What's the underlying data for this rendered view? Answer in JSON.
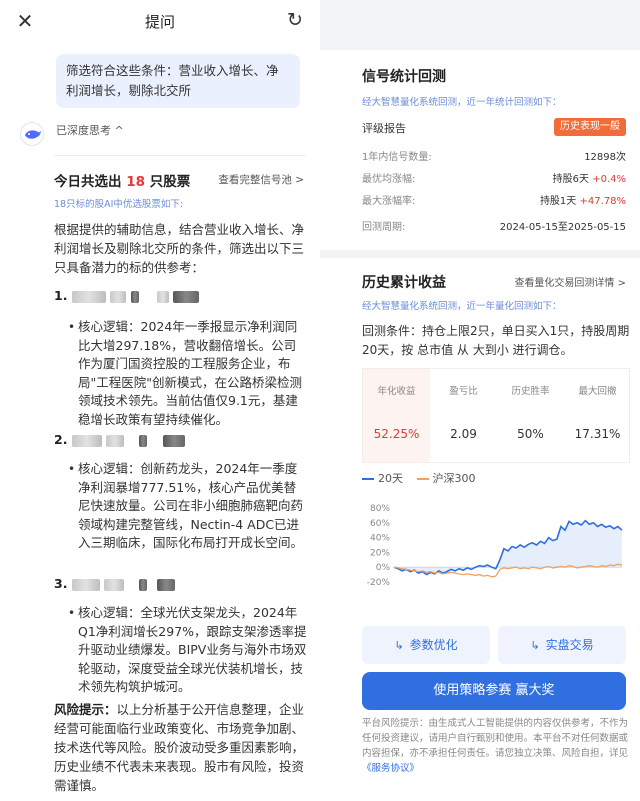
{
  "header": {
    "close_icon": "close-icon",
    "title": "提问",
    "refresh_icon": "refresh-icon"
  },
  "query": {
    "text": "筛选符合这些条件：营业收入增长、净利润增长，剔除北交所"
  },
  "thinking": {
    "label": "已深度思考 ^"
  },
  "result": {
    "head_prefix": "今日共选出",
    "count": "18",
    "head_suffix": "只股票",
    "link": "查看完整信号池 >",
    "sub": "18只标的股AI中优选股票如下:",
    "intro": "根据提供的辅助信息，结合营业收入增长、净利润增长及剔除北交所的条件，筛选出以下三只具备潜力的标的供参考：",
    "items": [
      {
        "index": "1.",
        "body": "核心逻辑：2024年一季报显示净利润同比大增297.18%，营收翻倍增长。公司作为厦门国资控股的工程服务企业，布局\"工程医院\"创新模式，在公路桥梁检测领域技术领先。当前估值仅9.1元，基建稳增长政策有望持续催化。"
      },
      {
        "index": "2.",
        "body": "核心逻辑：创新药龙头，2024年一季度净利润暴增777.51%，核心产品优美替尼快速放量。公司在非小细胞肺癌靶向药领域构建完整管线，Nectin-4 ADC已进入三期临床，国际化布局打开成长空间。"
      },
      {
        "index": "3.",
        "body": "核心逻辑：全球光伏支架龙头，2024年Q1净利润增长297%，跟踪支架渗透率提升驱动业绩爆发。BIPV业务与海外市场双轮驱动，深度受益全球光伏装机增长，技术领先构筑护城河。"
      }
    ],
    "risk_label": "风险提示：",
    "risk_text": "以上分析基于公开信息整理，企业经营可能面临行业政策变化、市场竞争加剧、技术迭代等风险。股价波动受多重因素影响，历史业绩不代表未来表现。股市有风险，投资需谨慎。"
  },
  "signal": {
    "title": "信号统计回测",
    "sub": "经大智慧量化系统回测，近一年统计回测如下：",
    "rating_label": "评级报告",
    "rating_badge": "历史表现一般",
    "rows": [
      {
        "k": "1年内信号数量:",
        "v": "12898次",
        "v_red": ""
      },
      {
        "k": "最优均涨幅:",
        "v": "持股6天 ",
        "v_red": "+0.4%"
      },
      {
        "k": "最大涨幅率:",
        "v": "持股1天 ",
        "v_red": "+47.78%"
      },
      {
        "k": "回测周期:",
        "v": "2024-05-15至2025-05-15",
        "v_red": ""
      }
    ]
  },
  "history": {
    "title": "历史累计收益",
    "link": "查看量化交易回测详情 >",
    "sub": "经大智慧量化系统回测，近一年量化回测如下：",
    "cond": "回测条件：持仓上限2只，单日买入1只，持股周期20天，按 总市值 从 大到小 进行调仓。",
    "stat_headers": [
      "年化收益",
      "盈亏比",
      "历史胜率",
      "最大回撤"
    ],
    "stat_values": [
      "52.25%",
      "2.09",
      "50%",
      "17.31%"
    ],
    "legend": [
      "20天",
      "沪深300"
    ],
    "btn_opt": "参数优化",
    "btn_live": "实盘交易",
    "btn_main": "使用策略参赛 赢大奖",
    "disclaimer": "平台风险提示：由生成式人工智能提供的内容仅供参考，不作为任何投资建议，请用户自行甄别和使用。本平台不对任何数据或内容担保，亦不承担任何责任。请您独立决策、风险自担，详见",
    "disclaimer_link": "《服务协议》"
  },
  "chart_data": {
    "type": "line",
    "title": "",
    "xlabel": "",
    "ylabel": "",
    "y_ticks": [
      "80%",
      "60%",
      "40%",
      "20%",
      "0%",
      "-20%"
    ],
    "ylim": [
      -20,
      80
    ],
    "colors": {
      "s1": "#2f6fe0",
      "s2": "#f0a060"
    },
    "series": [
      {
        "name": "20天",
        "values": [
          0,
          -2,
          -5,
          -3,
          -6,
          -4,
          -8,
          -6,
          -10,
          -7,
          -9,
          -5,
          -8,
          -6,
          -3,
          -5,
          -2,
          -4,
          -1,
          -3,
          0,
          2,
          1,
          3,
          0,
          -2,
          10,
          25,
          22,
          28,
          26,
          30,
          27,
          31,
          33,
          30,
          35,
          32,
          40,
          36,
          38,
          55,
          50,
          62,
          58,
          60,
          57,
          63,
          58,
          60,
          55,
          58,
          54,
          56,
          52,
          55,
          50
        ]
      },
      {
        "name": "沪深300",
        "values": [
          0,
          -1,
          -2,
          -3,
          -4,
          -5,
          -6,
          -5,
          -7,
          -6,
          -8,
          -7,
          -9,
          -8,
          -7,
          -8,
          -9,
          -10,
          -9,
          -10,
          -11,
          -10,
          -12,
          -11,
          -13,
          -12,
          -3,
          -1,
          -2,
          -1,
          0,
          -2,
          -1,
          -2,
          0,
          -1,
          -2,
          0,
          1,
          -1,
          0,
          1,
          0,
          2,
          1,
          -1,
          0,
          1,
          2,
          1,
          0,
          2,
          1,
          3,
          2,
          4,
          3
        ]
      }
    ]
  }
}
